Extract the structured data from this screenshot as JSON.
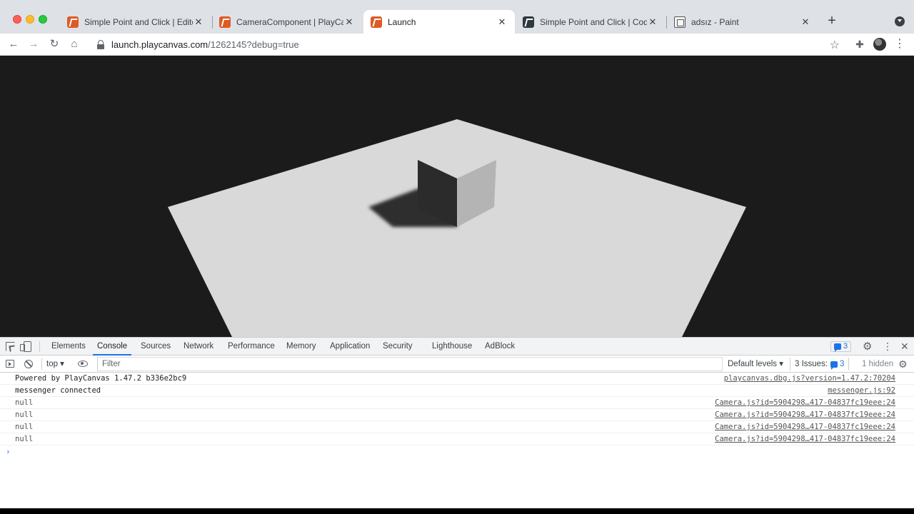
{
  "tabs": [
    {
      "label": "Simple Point and Click | Editor",
      "favicon": "playcanvas-icon",
      "active": false
    },
    {
      "label": "CameraComponent | PlayCanvas",
      "favicon": "playcanvas-icon",
      "active": false
    },
    {
      "label": "Launch",
      "favicon": "playcanvas-icon",
      "active": true
    },
    {
      "label": "Simple Point and Click | Code Editor",
      "favicon": "code-editor-icon",
      "active": false
    },
    {
      "label": "adsız - Paint",
      "favicon": "paint-icon",
      "active": false
    }
  ],
  "toolbar": {
    "url_host": "launch.playcanvas.com",
    "url_path": "/1262145?debug=true"
  },
  "devtools": {
    "tabs": [
      "Elements",
      "Console",
      "Sources",
      "Network",
      "Performance",
      "Memory",
      "Application",
      "Security",
      "Lighthouse",
      "AdBlock"
    ],
    "active_tab": "Console",
    "messages_badge": "3",
    "context": "top ▾",
    "filter_placeholder": "Filter",
    "levels": "Default levels ▾",
    "issues_label": "3 Issues:",
    "issues_count": "3",
    "hidden": "1 hidden"
  },
  "console": {
    "rows": [
      {
        "message": "Powered by PlayCanvas 1.47.2 b336e2bc9",
        "source": "playcanvas.dbg.js?version=1.47.2:70204"
      },
      {
        "message": "messenger connected",
        "source": "messenger.js:92"
      },
      {
        "message": "null",
        "source": "Camera.js?id=5904298…417-04837fc19eee:24"
      },
      {
        "message": "null",
        "source": "Camera.js?id=5904298…417-04837fc19eee:24"
      },
      {
        "message": "null",
        "source": "Camera.js?id=5904298…417-04837fc19eee:24"
      },
      {
        "message": "null",
        "source": "Camera.js?id=5904298…417-04837fc19eee:24"
      }
    ],
    "prompt": "›"
  },
  "colors": {
    "viewport_bg": "#1b1b1b",
    "plane": "#d9d9d9",
    "accent": "#1a73e8"
  }
}
